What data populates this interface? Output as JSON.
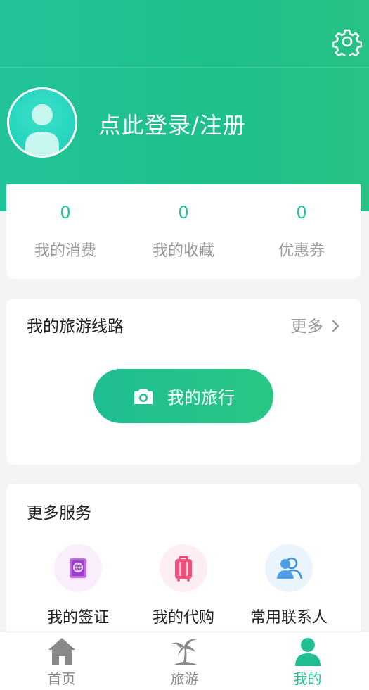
{
  "colors": {
    "brand": "#22c39a",
    "brand_text": "#26bf9b",
    "muted": "#9a9a9a",
    "background": "#f4f4f4"
  },
  "header": {
    "settings_icon": "gear-icon",
    "avatar_icon": "user-avatar-icon",
    "login_label": "点此登录/注册"
  },
  "stats": [
    {
      "value": "0",
      "label": "我的消费"
    },
    {
      "value": "0",
      "label": "我的收藏"
    },
    {
      "value": "0",
      "label": "优惠券"
    }
  ],
  "routes": {
    "title": "我的旅游线路",
    "more_label": "更多",
    "more_icon": "chevron-right-icon",
    "trip_button": "我的旅行",
    "trip_icon": "camera-icon"
  },
  "services": {
    "title": "更多服务",
    "items": [
      {
        "label": "我的签证",
        "icon": "passport-icon",
        "color": "#b14fd8"
      },
      {
        "label": "我的代购",
        "icon": "suitcase-icon",
        "color": "#f0436a"
      },
      {
        "label": "常用联系人",
        "icon": "contacts-icon",
        "color": "#3c8fdd"
      }
    ]
  },
  "tabbar": [
    {
      "label": "首页",
      "icon": "home-icon",
      "active": false
    },
    {
      "label": "旅游",
      "icon": "palm-tree-icon",
      "active": false
    },
    {
      "label": "我的",
      "icon": "person-icon",
      "active": true
    }
  ]
}
